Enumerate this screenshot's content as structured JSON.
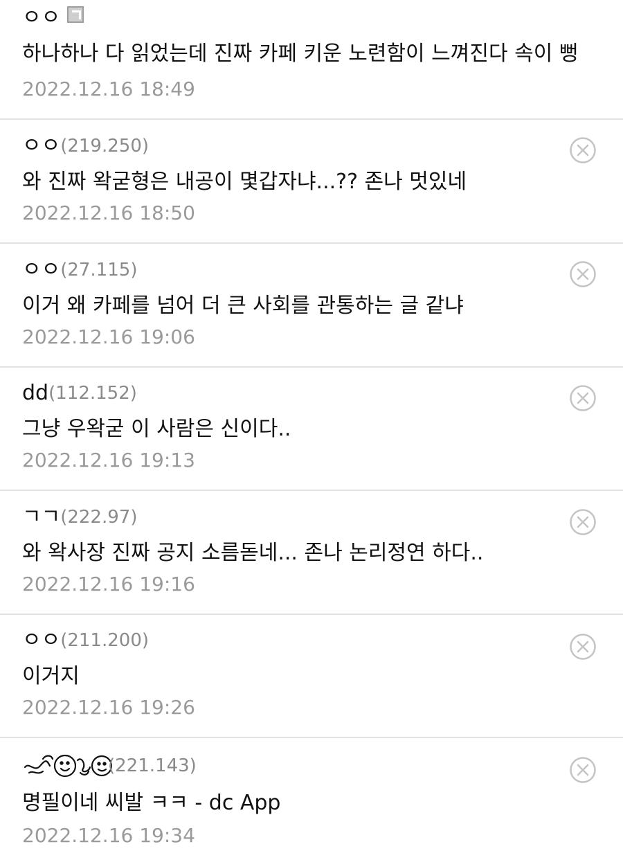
{
  "comments": [
    {
      "nick": "ㅇㅇ",
      "ip": "",
      "fixed_nick_icon": true,
      "body": "하나하나 다 읽었는데 진짜 카페 키운 노련함이 느껴진다 속이 뻥",
      "date": "2022.12.16 18:49",
      "deletable": false
    },
    {
      "nick": "ㅇㅇ",
      "ip": "(219.250)",
      "body": "와 진짜 왁굳형은 내공이 몇갑자냐...?? 존나 멋있네",
      "date": "2022.12.16 18:50",
      "deletable": true
    },
    {
      "nick": "ㅇㅇ",
      "ip": "(27.115)",
      "body": "이거 왜 카페를 넘어 더 큰 사회를 관통하는 글 같냐",
      "date": "2022.12.16 19:06",
      "deletable": true
    },
    {
      "nick": "dd",
      "ip": "(112.152)",
      "body": "그냥 우왁굳 이 사람은 신이다..",
      "date": "2022.12.16 19:13",
      "deletable": true
    },
    {
      "nick": "ㄱㄱ",
      "ip": "(222.97)",
      "body": "와 왁사장 진짜 공지 소름돋네... 존나 논리정연 하다..",
      "date": "2022.12.16 19:16",
      "deletable": true
    },
    {
      "nick": "ㅇㅇ",
      "ip": "(211.200)",
      "body": "이거지",
      "date": "2022.12.16 19:26",
      "deletable": true
    },
    {
      "nick": "",
      "nick_image": "dccon-nick-image",
      "ip": "(221.143)",
      "body": "명필이네 씨발 ㅋㅋ - dc App",
      "date": "2022.12.16 19:34",
      "deletable": true
    }
  ],
  "icons": {
    "delete": "circle-x-icon",
    "fixed_nick": "fixed-nick-icon"
  },
  "colors": {
    "ip_text": "#8a8a8a",
    "date_text": "#9a9a9a",
    "divider": "#e2e2e2",
    "delete_icon": "#c4c4c4"
  }
}
